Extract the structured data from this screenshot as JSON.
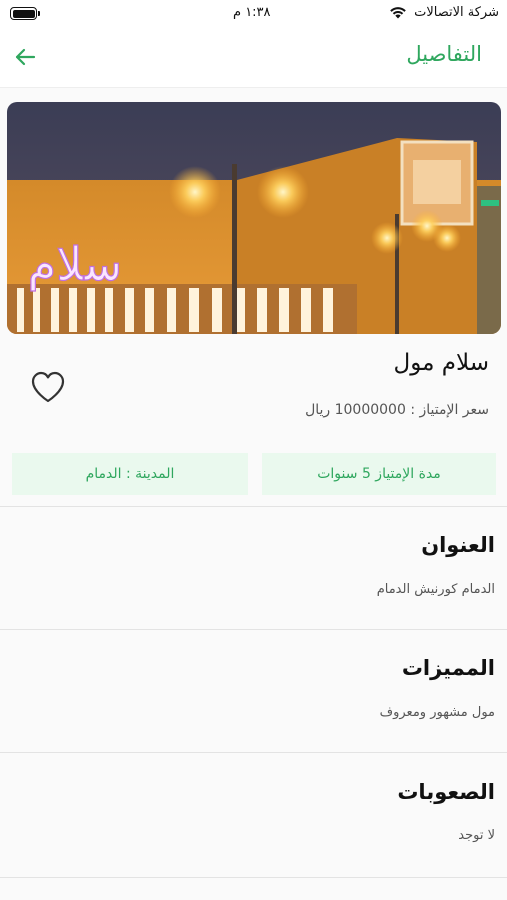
{
  "status": {
    "carrier": "شركة الاتصالات",
    "time": "١:٣٨ م"
  },
  "header": {
    "title": "التفاصيل"
  },
  "hero": {
    "sign_text": "سلام"
  },
  "listing": {
    "name": "سلام مول",
    "price": "سعر الإمتياز : 10000000 ريال",
    "duration": "مدة الإمتياز  5 سنوات",
    "city": "المدينة : الدمام"
  },
  "sections": {
    "address": {
      "title": "العنوان",
      "text": "الدمام كورنيش الدمام"
    },
    "features": {
      "title": "المميزات",
      "text": "مول مشهور ومعروف"
    },
    "difficulties": {
      "title": "الصعوبات",
      "text": "لا توجد"
    }
  },
  "colors": {
    "accent": "#2fa75e",
    "chip_bg": "#eaf9ee"
  }
}
